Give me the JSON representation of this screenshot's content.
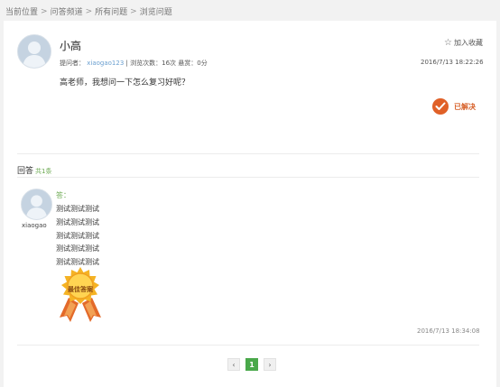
{
  "breadcrumb": {
    "items": [
      "当前位置",
      "问答频道",
      "所有问题",
      "浏览问题"
    ],
    "separator": ">"
  },
  "question": {
    "author": "小高",
    "follow_label": "加入收藏",
    "meta": {
      "asker_label": "提问者：",
      "asker_name": "xiaogao123",
      "views_label": "浏览次数：16次",
      "reward_label": "悬赏：0分"
    },
    "time": "2016/7/13 18:22:26",
    "body": "高老师，我想问一下怎么复习好呢？",
    "status": "已解决"
  },
  "answers": {
    "heading": "回答",
    "count": "共1条",
    "items": [
      {
        "user": "xiaogao",
        "label": "答：",
        "lines": [
          "测试测试测试",
          "测试测试测试",
          "测试测试测试",
          "测试测试测试",
          "测试测试测试"
        ],
        "badge": "最佳答案",
        "time": "2016/7/13 18:34:08"
      }
    ]
  },
  "pagination": {
    "prev": "‹",
    "current": "1",
    "next": "›"
  },
  "colors": {
    "accent_green": "#49a84a",
    "status_orange": "#e06027",
    "link_blue": "#6a9fd0"
  }
}
